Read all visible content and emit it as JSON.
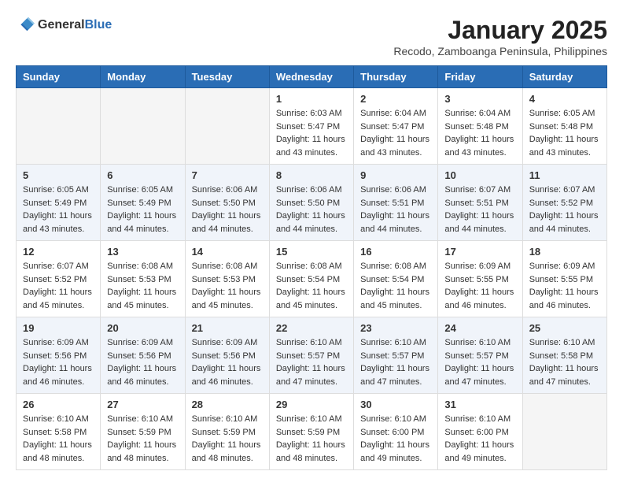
{
  "logo": {
    "text_general": "General",
    "text_blue": "Blue"
  },
  "title": {
    "main": "January 2025",
    "subtitle": "Recodo, Zamboanga Peninsula, Philippines"
  },
  "headers": [
    "Sunday",
    "Monday",
    "Tuesday",
    "Wednesday",
    "Thursday",
    "Friday",
    "Saturday"
  ],
  "weeks": [
    {
      "days": [
        {
          "date": "",
          "info": ""
        },
        {
          "date": "",
          "info": ""
        },
        {
          "date": "",
          "info": ""
        },
        {
          "date": "1",
          "info": "Sunrise: 6:03 AM\nSunset: 5:47 PM\nDaylight: 11 hours\nand 43 minutes."
        },
        {
          "date": "2",
          "info": "Sunrise: 6:04 AM\nSunset: 5:47 PM\nDaylight: 11 hours\nand 43 minutes."
        },
        {
          "date": "3",
          "info": "Sunrise: 6:04 AM\nSunset: 5:48 PM\nDaylight: 11 hours\nand 43 minutes."
        },
        {
          "date": "4",
          "info": "Sunrise: 6:05 AM\nSunset: 5:48 PM\nDaylight: 11 hours\nand 43 minutes."
        }
      ]
    },
    {
      "days": [
        {
          "date": "5",
          "info": "Sunrise: 6:05 AM\nSunset: 5:49 PM\nDaylight: 11 hours\nand 43 minutes."
        },
        {
          "date": "6",
          "info": "Sunrise: 6:05 AM\nSunset: 5:49 PM\nDaylight: 11 hours\nand 44 minutes."
        },
        {
          "date": "7",
          "info": "Sunrise: 6:06 AM\nSunset: 5:50 PM\nDaylight: 11 hours\nand 44 minutes."
        },
        {
          "date": "8",
          "info": "Sunrise: 6:06 AM\nSunset: 5:50 PM\nDaylight: 11 hours\nand 44 minutes."
        },
        {
          "date": "9",
          "info": "Sunrise: 6:06 AM\nSunset: 5:51 PM\nDaylight: 11 hours\nand 44 minutes."
        },
        {
          "date": "10",
          "info": "Sunrise: 6:07 AM\nSunset: 5:51 PM\nDaylight: 11 hours\nand 44 minutes."
        },
        {
          "date": "11",
          "info": "Sunrise: 6:07 AM\nSunset: 5:52 PM\nDaylight: 11 hours\nand 44 minutes."
        }
      ]
    },
    {
      "days": [
        {
          "date": "12",
          "info": "Sunrise: 6:07 AM\nSunset: 5:52 PM\nDaylight: 11 hours\nand 45 minutes."
        },
        {
          "date": "13",
          "info": "Sunrise: 6:08 AM\nSunset: 5:53 PM\nDaylight: 11 hours\nand 45 minutes."
        },
        {
          "date": "14",
          "info": "Sunrise: 6:08 AM\nSunset: 5:53 PM\nDaylight: 11 hours\nand 45 minutes."
        },
        {
          "date": "15",
          "info": "Sunrise: 6:08 AM\nSunset: 5:54 PM\nDaylight: 11 hours\nand 45 minutes."
        },
        {
          "date": "16",
          "info": "Sunrise: 6:08 AM\nSunset: 5:54 PM\nDaylight: 11 hours\nand 45 minutes."
        },
        {
          "date": "17",
          "info": "Sunrise: 6:09 AM\nSunset: 5:55 PM\nDaylight: 11 hours\nand 46 minutes."
        },
        {
          "date": "18",
          "info": "Sunrise: 6:09 AM\nSunset: 5:55 PM\nDaylight: 11 hours\nand 46 minutes."
        }
      ]
    },
    {
      "days": [
        {
          "date": "19",
          "info": "Sunrise: 6:09 AM\nSunset: 5:56 PM\nDaylight: 11 hours\nand 46 minutes."
        },
        {
          "date": "20",
          "info": "Sunrise: 6:09 AM\nSunset: 5:56 PM\nDaylight: 11 hours\nand 46 minutes."
        },
        {
          "date": "21",
          "info": "Sunrise: 6:09 AM\nSunset: 5:56 PM\nDaylight: 11 hours\nand 46 minutes."
        },
        {
          "date": "22",
          "info": "Sunrise: 6:10 AM\nSunset: 5:57 PM\nDaylight: 11 hours\nand 47 minutes."
        },
        {
          "date": "23",
          "info": "Sunrise: 6:10 AM\nSunset: 5:57 PM\nDaylight: 11 hours\nand 47 minutes."
        },
        {
          "date": "24",
          "info": "Sunrise: 6:10 AM\nSunset: 5:57 PM\nDaylight: 11 hours\nand 47 minutes."
        },
        {
          "date": "25",
          "info": "Sunrise: 6:10 AM\nSunset: 5:58 PM\nDaylight: 11 hours\nand 47 minutes."
        }
      ]
    },
    {
      "days": [
        {
          "date": "26",
          "info": "Sunrise: 6:10 AM\nSunset: 5:58 PM\nDaylight: 11 hours\nand 48 minutes."
        },
        {
          "date": "27",
          "info": "Sunrise: 6:10 AM\nSunset: 5:59 PM\nDaylight: 11 hours\nand 48 minutes."
        },
        {
          "date": "28",
          "info": "Sunrise: 6:10 AM\nSunset: 5:59 PM\nDaylight: 11 hours\nand 48 minutes."
        },
        {
          "date": "29",
          "info": "Sunrise: 6:10 AM\nSunset: 5:59 PM\nDaylight: 11 hours\nand 48 minutes."
        },
        {
          "date": "30",
          "info": "Sunrise: 6:10 AM\nSunset: 6:00 PM\nDaylight: 11 hours\nand 49 minutes."
        },
        {
          "date": "31",
          "info": "Sunrise: 6:10 AM\nSunset: 6:00 PM\nDaylight: 11 hours\nand 49 minutes."
        },
        {
          "date": "",
          "info": ""
        }
      ]
    }
  ]
}
